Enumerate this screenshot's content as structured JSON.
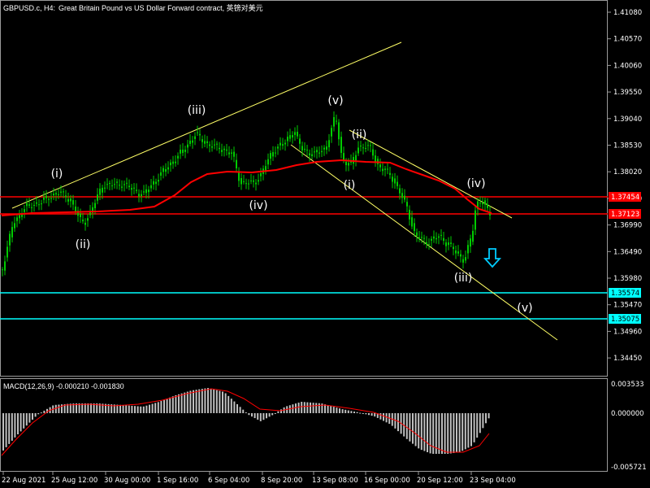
{
  "header": {
    "symbol": "GBPUSD.c, H4:",
    "description": "Great Britain Pound vs US Dollar Forward contract, 英镑对美元"
  },
  "macd": {
    "label": "MACD(12,26,9) -0.000210 -0.001830",
    "axis": [
      "0.003533",
      "0.000000",
      "-0.005721"
    ]
  },
  "price_axis": [
    "1.41080",
    "1.40570",
    "1.40060",
    "1.39550",
    "1.39040",
    "1.38530",
    "1.38020",
    "1.37510",
    "1.36990",
    "1.36490",
    "1.35980",
    "1.35470",
    "1.34960",
    "1.34450"
  ],
  "level_badges": {
    "red_upper": "1.37454",
    "red_lower": "1.37123",
    "cyan_upper": "1.35574",
    "cyan_lower": "1.35075"
  },
  "time_axis": [
    "22 Aug 2021",
    "25 Aug 12:00",
    "30 Aug 00:00",
    "1 Sep 16:00",
    "6 Sep 04:00",
    "8 Sep 20:00",
    "13 Sep 08:00",
    "16 Sep 00:00",
    "20 Sep 12:00",
    "23 Sep 04:00"
  ],
  "wave_labels": [
    "(i)",
    "(ii)",
    "(iii)",
    "(iv)",
    "(v)",
    "(ii)",
    "(i)",
    "(iv)",
    "(iii)",
    "(v)"
  ],
  "colors": {
    "background": "#000000",
    "candle": "#00cc00",
    "moving_average": "#ff0000",
    "trendline": "#ffff66",
    "support": "#00ffff",
    "resistance": "#ff0000",
    "arrow": "#00ccff",
    "macd_hist": "#c0c0c0",
    "macd_signal": "#ff0000"
  },
  "icons": [
    "down-arrow-icon"
  ]
}
